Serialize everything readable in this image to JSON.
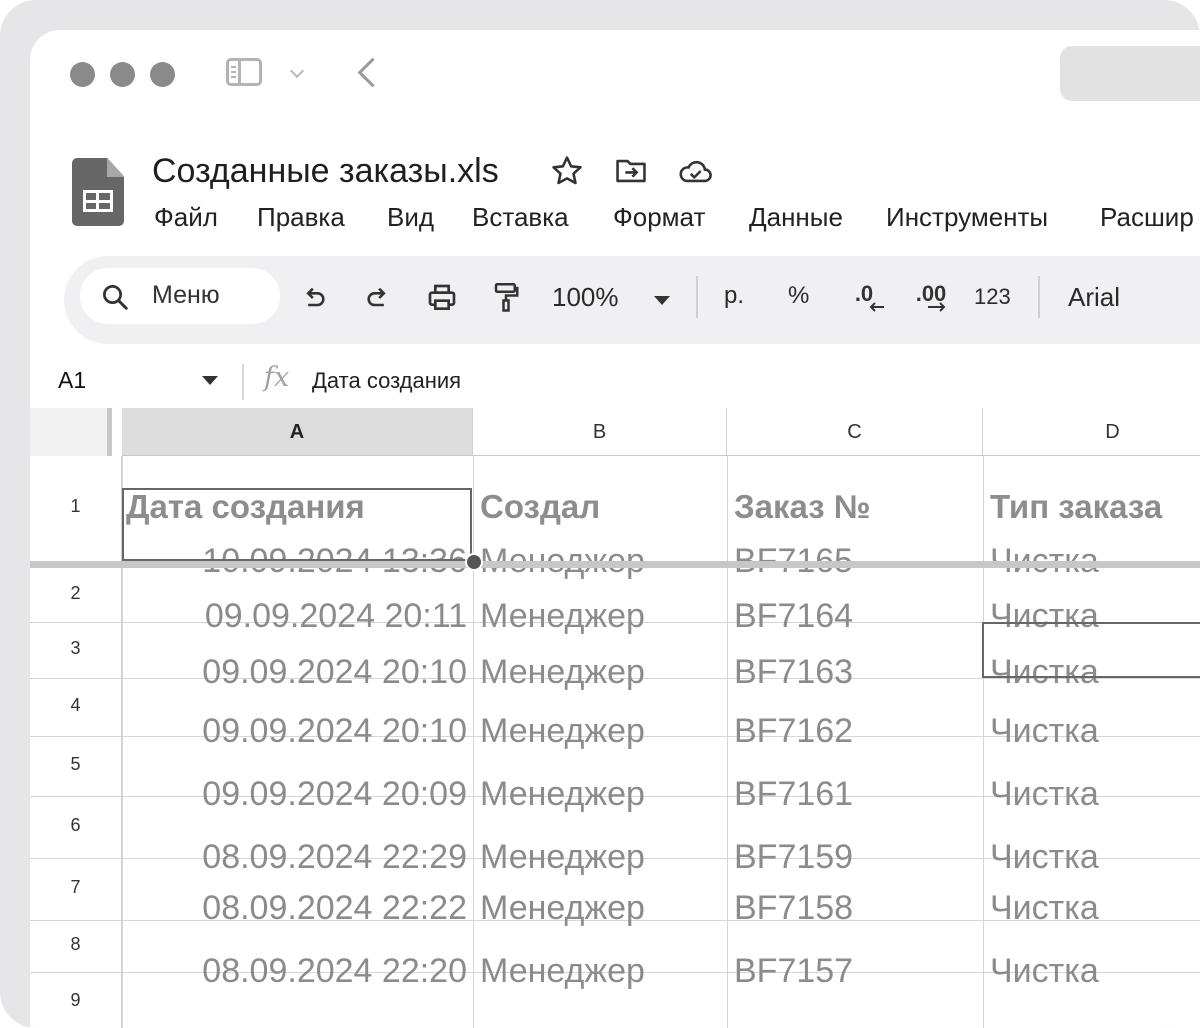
{
  "document": {
    "title": "Созданные заказы.xls"
  },
  "menu": [
    "Файл",
    "Правка",
    "Вид",
    "Вставка",
    "Формат",
    "Данные",
    "Инструменты",
    "Расшир"
  ],
  "toolbar": {
    "search_label": "Меню",
    "zoom": "100%",
    "currency": "р.",
    "percent": "%",
    "decrease_decimals": ".0",
    "increase_decimals": ".00",
    "number_format": "123",
    "font": "Arial"
  },
  "formula_bar": {
    "cell_ref": "A1",
    "fx": "fx",
    "value": "Дата создания"
  },
  "sheet": {
    "columns": [
      "A",
      "B",
      "C",
      "D"
    ],
    "row_numbers": [
      "1",
      "2",
      "3",
      "4",
      "5",
      "6",
      "7",
      "8",
      "9"
    ],
    "header": [
      "Дата создания",
      "Создал",
      "Заказ №",
      "Тип заказа"
    ],
    "rows": [
      [
        "10.09.2024 13:36",
        "Менеджер",
        "BF7165",
        "Чистка"
      ],
      [
        "09.09.2024 20:11",
        "Менеджер",
        "BF7164",
        "Чистка"
      ],
      [
        "09.09.2024 20:10",
        "Менеджер",
        "BF7163",
        "Чистка"
      ],
      [
        "09.09.2024 20:10",
        "Менеджер",
        "BF7162",
        "Чистка"
      ],
      [
        "09.09.2024 20:09",
        "Менеджер",
        "BF7161",
        "Чистка"
      ],
      [
        "08.09.2024 22:29",
        "Менеджер",
        "BF7159",
        "Чистка"
      ],
      [
        "08.09.2024 22:22",
        "Менеджер",
        "BF7158",
        "Чистка"
      ],
      [
        "08.09.2024 22:20",
        "Менеджер",
        "BF7157",
        "Чистка"
      ]
    ]
  },
  "icons": {
    "star": "star-icon",
    "move": "folder-move-icon",
    "cloud": "cloud-saved-icon",
    "undo": "undo-icon",
    "redo": "redo-icon",
    "print": "print-icon",
    "paint": "paint-format-icon"
  }
}
